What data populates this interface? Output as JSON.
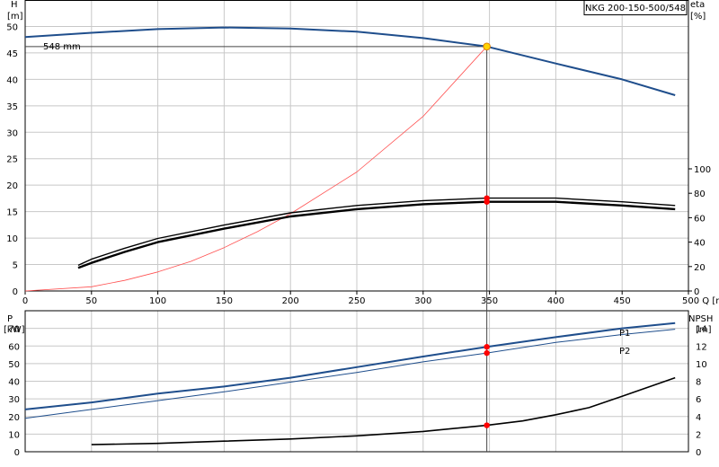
{
  "chart_data": [
    {
      "type": "line",
      "title": "NKG 200-150-500/548",
      "left_axis": {
        "label": "H",
        "unit": "[m]",
        "ylim": [
          0,
          55
        ],
        "ticks": [
          0,
          5,
          10,
          15,
          20,
          25,
          30,
          35,
          40,
          45,
          50
        ]
      },
      "right_axis": {
        "label": "eta",
        "unit": "[%]",
        "ylim": [
          0,
          100
        ],
        "ticks": [
          0,
          20,
          40,
          60,
          80,
          100
        ]
      },
      "x_axis": {
        "label": "Q [m³/h]",
        "xlim": [
          0,
          500
        ],
        "ticks": [
          0,
          50,
          100,
          150,
          200,
          250,
          300,
          350,
          400,
          450,
          500
        ],
        "tick_labels": [
          "0",
          "50",
          "100",
          "150",
          "200",
          "250",
          "300",
          "350",
          "400",
          "450",
          "500 Q [m³/h]"
        ]
      },
      "grid": true,
      "impeller_label": "548 mm",
      "operating_point": {
        "q": 348,
        "h": 46.2,
        "eta_upper": 76,
        "eta_lower": 73
      },
      "series": [
        {
          "key": "h_curve",
          "axis": "left",
          "color": "#1f4e8c",
          "width": 2,
          "x": [
            0,
            50,
            100,
            150,
            200,
            250,
            300,
            348,
            400,
            450,
            490
          ],
          "y": [
            48,
            48.8,
            49.5,
            49.8,
            49.6,
            49,
            47.8,
            46.2,
            43,
            40,
            37
          ]
        },
        {
          "key": "system_curve",
          "axis": "left",
          "color": "#ff5050",
          "width": 0.8,
          "x": [
            0,
            50,
            75,
            100,
            125,
            150,
            175,
            200,
            250,
            300,
            348
          ],
          "y": [
            0,
            0.8,
            2,
            3.6,
            5.6,
            8.2,
            11.2,
            14.6,
            22.5,
            33,
            46.2
          ]
        },
        {
          "key": "eta_upper",
          "axis": "right",
          "color": "#000000",
          "width": 1.4,
          "x": [
            40,
            50,
            75,
            100,
            150,
            200,
            250,
            300,
            348,
            400,
            450,
            490
          ],
          "y": [
            21,
            26,
            35,
            43,
            54,
            64,
            70,
            74,
            76,
            76,
            73,
            70
          ]
        },
        {
          "key": "eta_lower",
          "axis": "right",
          "color": "#000000",
          "width": 2.4,
          "x": [
            40,
            50,
            75,
            100,
            150,
            200,
            250,
            300,
            348,
            400,
            450,
            490
          ],
          "y": [
            19,
            23,
            32,
            40,
            51,
            61,
            67,
            71,
            73,
            73,
            70,
            67
          ]
        }
      ]
    },
    {
      "type": "line",
      "left_axis": {
        "label": "P",
        "unit": "[kW]",
        "ylim": [
          0,
          80
        ],
        "ticks": [
          0,
          10,
          20,
          30,
          40,
          50,
          60,
          70
        ]
      },
      "right_axis": {
        "label": "NPSH",
        "unit": "[m]",
        "ylim": [
          0,
          16
        ],
        "ticks": [
          0,
          2,
          4,
          6,
          8,
          10,
          12,
          14
        ]
      },
      "x_axis": {
        "xlim": [
          0,
          500
        ]
      },
      "grid": true,
      "series": [
        {
          "key": "p1",
          "name": "P1",
          "axis": "left",
          "color": "#1f4e8c",
          "width": 2,
          "x": [
            0,
            50,
            100,
            150,
            200,
            250,
            300,
            348,
            400,
            450,
            490
          ],
          "y": [
            24,
            28,
            33,
            37,
            42,
            48,
            54,
            59.5,
            65,
            70,
            73
          ]
        },
        {
          "key": "p2",
          "name": "P2",
          "axis": "left",
          "color": "#1f4e8c",
          "width": 1,
          "x": [
            0,
            50,
            100,
            150,
            200,
            250,
            300,
            348,
            400,
            450,
            490
          ],
          "y": [
            19,
            24,
            29,
            34,
            39.5,
            45,
            51,
            56,
            62,
            66.5,
            69.5
          ]
        },
        {
          "key": "npsh",
          "axis": "right",
          "color": "#000000",
          "width": 1.6,
          "x": [
            50,
            100,
            150,
            200,
            250,
            300,
            348,
            375,
            400,
            425,
            450,
            490
          ],
          "y": [
            0.8,
            0.95,
            1.2,
            1.45,
            1.8,
            2.3,
            3,
            3.5,
            4.2,
            5,
            6.3,
            8.4
          ]
        }
      ],
      "markers": [
        {
          "series": "p1",
          "x": 348,
          "y": 59.5
        },
        {
          "series": "p2",
          "x": 348,
          "y": 56
        },
        {
          "series": "npsh",
          "x": 348,
          "y": 3
        }
      ]
    }
  ]
}
